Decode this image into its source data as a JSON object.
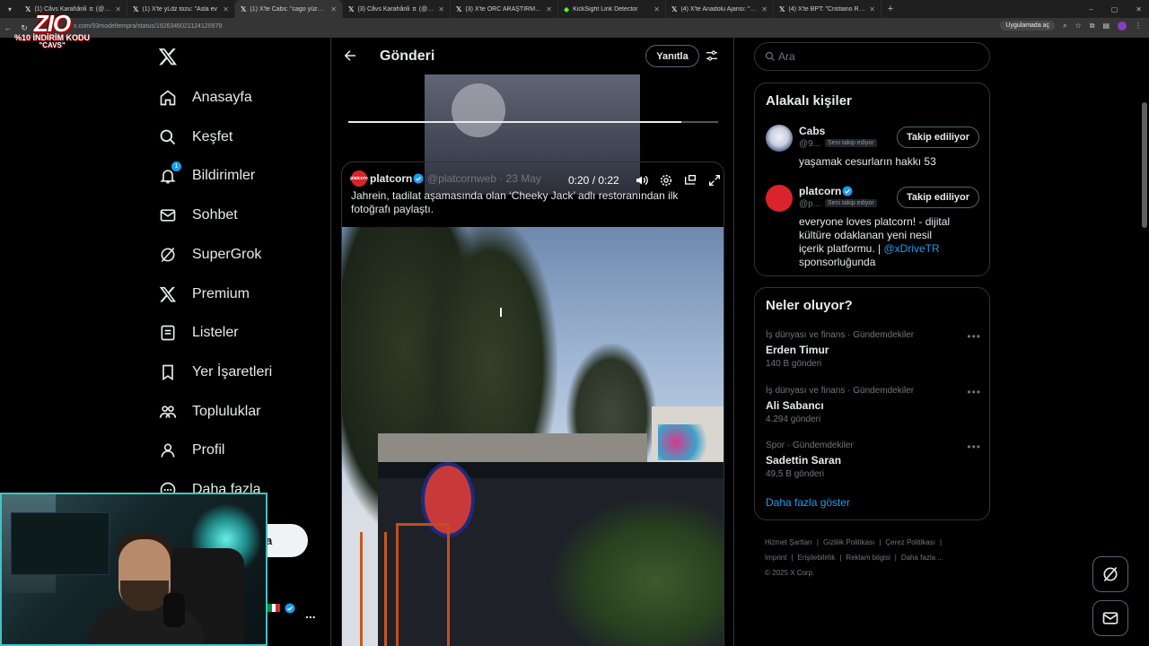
{
  "browser": {
    "tabs": [
      {
        "favicon": "x-logo-icon",
        "title": "(1) Câvs Karahânli ㅍ (@karahan",
        "active": false
      },
      {
        "favicon": "x-logo-icon",
        "title": "(1) X'te yLdz tozu: \"Asla ev",
        "active": false
      },
      {
        "favicon": "x-logo-icon",
        "title": "(1) X'te Cabs: \"cago yüzünden",
        "active": true
      },
      {
        "favicon": "x-logo-icon",
        "title": "(3) Câvs Karahânli ㅍ (@karahan",
        "active": false
      },
      {
        "favicon": "x-logo-icon",
        "title": "(3) X'te ORC ARAŞTIRMA: \"SİYA",
        "active": false
      },
      {
        "favicon": "kicksight-icon",
        "title": "KickSight Link Detector",
        "active": false
      },
      {
        "favicon": "x-logo-icon",
        "title": "(4) X'te Anadolu Ajansı: \"Kuzu",
        "active": false
      },
      {
        "favicon": "x-logo-icon",
        "title": "(4) X'te BPT: \"Cristiano Ronaldo",
        "active": false
      }
    ],
    "url": "x.com/93modeltempra/status/1926346021124120979",
    "open_in_app": "Uygulamada aç"
  },
  "overlay": {
    "logo_text": "ZIO",
    "promo_line1": "%10 İNDİRİM KODU",
    "promo_line2": "\"CAVS\""
  },
  "nav": {
    "items": [
      {
        "label": "Anasayfa",
        "icon": "home-icon"
      },
      {
        "label": "Keşfet",
        "icon": "search-icon"
      },
      {
        "label": "Bildirimler",
        "icon": "bell-icon",
        "badge": "1"
      },
      {
        "label": "Sohbet",
        "icon": "mail-icon"
      },
      {
        "label": "SuperGrok",
        "icon": "grok-icon"
      },
      {
        "label": "Premium",
        "icon": "x-logo-icon"
      },
      {
        "label": "Listeler",
        "icon": "list-icon"
      },
      {
        "label": "Yer İşaretleri",
        "icon": "bookmark-icon"
      },
      {
        "label": "Topluluklar",
        "icon": "communities-icon"
      },
      {
        "label": "Profil",
        "icon": "profile-icon"
      },
      {
        "label": "Daha fazla",
        "icon": "more-circle-icon"
      }
    ],
    "post_button_visible_text": "a",
    "account_more": "..."
  },
  "header": {
    "title": "Gönderi",
    "reply_label": "Yanıtla"
  },
  "video": {
    "time": "0:20 / 0:22",
    "progress": 0.9
  },
  "quote": {
    "avatar_text": "platcorn",
    "name": "platcorn",
    "handle_date": "@platcornweb · 23 May",
    "text": "Jahrein, tadilat aşamasında olan ‘Cheeky Jack’ adlı restoranından ilk fotoğrafı paylaştı."
  },
  "search": {
    "placeholder": "Ara"
  },
  "related": {
    "title": "Alakalı kişiler",
    "people": [
      {
        "name": "Cabs",
        "handle": "@9...",
        "follows_you": "Seni takip ediyor",
        "bio": "yaşamak cesurların hakkı 53",
        "button": "Takip ediliyor"
      },
      {
        "name": "platcorn",
        "handle": "@p...",
        "follows_you": "Seni takip ediyor",
        "bio": "everyone loves platcorn! - dijital kültüre odaklanan yeni nesil içerik platformu. | ",
        "bio_link": "@xDriveTR",
        "bio_after": " sponsorluğunda",
        "button": "Takip ediliyor"
      }
    ]
  },
  "trends": {
    "title": "Neler oluyor?",
    "items": [
      {
        "category": "İş dünyası ve finans · Gündemdekiler",
        "name": "Erden Timur",
        "count": "140 B gönderi"
      },
      {
        "category": "İş dünyası ve finans · Gündemdekiler",
        "name": "Ali Sabancı",
        "count": "4.294 gönderi"
      },
      {
        "category": "Spor · Gündemdekiler",
        "name": "Sadettin Saran",
        "count": "49,5 B gönderi"
      }
    ],
    "show_more": "Daha fazla göster"
  },
  "footer": {
    "links": [
      "Hizmet Şartları",
      "Gizlilik Politikası",
      "Çerez Politikası",
      "Imprint",
      "Erişilebilirlik",
      "Reklam bilgisi",
      "Daha fazla ..."
    ],
    "copyright": "© 2025 X Corp."
  },
  "colors": {
    "accent": "#1d9bf0",
    "background": "#000000",
    "border": "#2f3336",
    "muted_text": "#71767b"
  }
}
